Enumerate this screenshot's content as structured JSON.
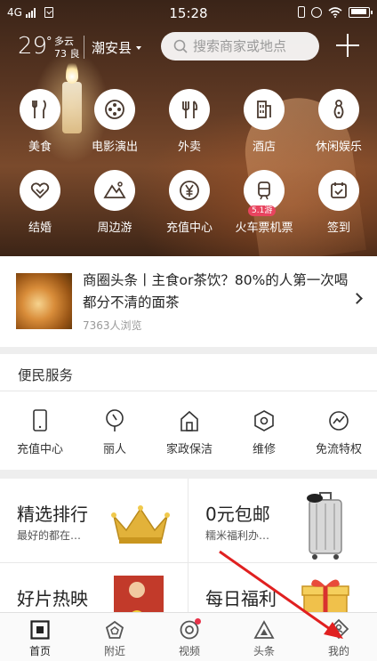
{
  "status_bar": {
    "network": "4G",
    "time": "15:28"
  },
  "header": {
    "temperature": "29",
    "temperature_unit": "°",
    "weather": "多云",
    "air_quality": "73 良",
    "city": "潮安县",
    "search_placeholder": "搜索商家或地点"
  },
  "categories": [
    {
      "label": "美食",
      "icon": "fork-knife-icon"
    },
    {
      "label": "电影演出",
      "icon": "film-reel-icon"
    },
    {
      "label": "外卖",
      "icon": "delivery-utensils-icon"
    },
    {
      "label": "酒店",
      "icon": "hotel-building-icon"
    },
    {
      "label": "休闲娱乐",
      "icon": "bowling-icon"
    },
    {
      "label": "结婚",
      "icon": "heart-icon"
    },
    {
      "label": "周边游",
      "icon": "mountain-icon"
    },
    {
      "label": "充值中心",
      "icon": "yen-coin-icon"
    },
    {
      "label": "火车票机票",
      "icon": "train-icon",
      "badge": "5.1游"
    },
    {
      "label": "签到",
      "icon": "calendar-check-icon"
    }
  ],
  "headline": {
    "text": "商圈头条丨主食or茶饮？80%的人第一次喝都分不清的面茶",
    "views": "7363人浏览"
  },
  "services": {
    "title": "便民服务",
    "items": [
      {
        "label": "充值中心",
        "icon": "phone-icon"
      },
      {
        "label": "丽人",
        "icon": "mirror-icon"
      },
      {
        "label": "家政保洁",
        "icon": "house-icon"
      },
      {
        "label": "维修",
        "icon": "hex-nut-icon"
      },
      {
        "label": "免流特权",
        "icon": "pulse-icon"
      }
    ]
  },
  "promos": [
    {
      "title": "精选排行",
      "subtitle": "最好的都在…",
      "icon": "crown-icon"
    },
    {
      "title": "0元包邮",
      "subtitle": "糯米福利办…",
      "icon": "suitcase-icon"
    },
    {
      "title": "好片热映",
      "subtitle": "",
      "icon": "movie-poster-icon"
    },
    {
      "title": "每日福利",
      "subtitle": "",
      "icon": "gift-box-icon"
    }
  ],
  "bottom_nav": [
    {
      "label": "首页",
      "icon": "home-square-icon",
      "active": true
    },
    {
      "label": "附近",
      "icon": "pentagon-icon"
    },
    {
      "label": "视频",
      "icon": "video-circle-icon",
      "dot": true
    },
    {
      "label": "头条",
      "icon": "triangle-icon"
    },
    {
      "label": "我的",
      "icon": "diamond-user-icon"
    }
  ],
  "colors": {
    "accent_red": "#e8334a",
    "annotation_red": "#e02020"
  }
}
